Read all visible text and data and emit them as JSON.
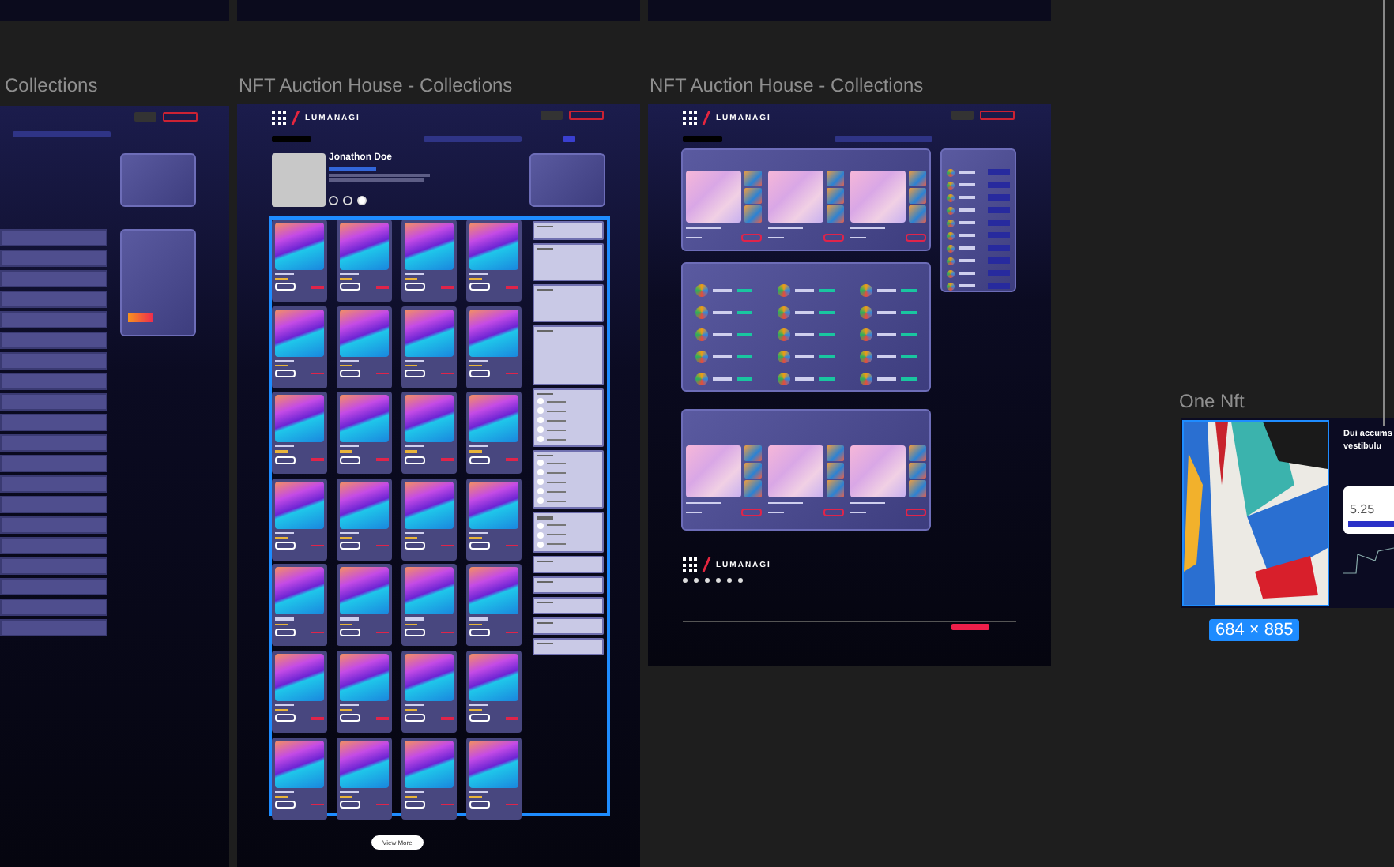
{
  "frames": [
    {
      "title": "Collections"
    },
    {
      "title": "NFT Auction House - Collections"
    },
    {
      "title": "NFT Auction House - Collections"
    },
    {
      "title": "One Nft"
    }
  ],
  "brand": [
    "LUMANAGI",
    "LUMANAGI",
    "LUMANAGI"
  ],
  "profile": {
    "name": "Jonathon Doe"
  },
  "view_more": "View More",
  "one_nft": {
    "heading_lines": [
      "Dui accums",
      "vestibulu"
    ],
    "price": "5.25",
    "size_badge": "684 × 885"
  }
}
